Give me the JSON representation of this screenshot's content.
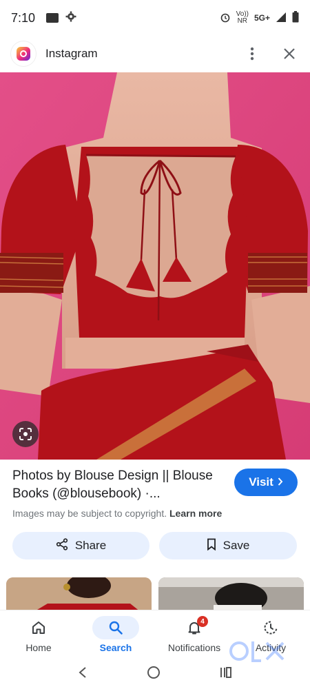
{
  "status_bar": {
    "time": "7:10",
    "network_label_top": "Vo))",
    "network_label_bottom": "NR",
    "network_type": "5G+"
  },
  "header": {
    "app_name": "Instagram",
    "logo_icon": "instagram-logo-icon",
    "more_icon": "more-vert-icon",
    "close_icon": "close-icon"
  },
  "image": {
    "lens_icon": "google-lens-icon"
  },
  "result": {
    "title": "Photos by Blouse Design || Blouse Books (@blousebook) ·...",
    "visit_label": "Visit",
    "copyright_text": "Images may be subject to copyright.",
    "learn_more": "Learn more",
    "share_label": "Share",
    "save_label": "Save"
  },
  "bottom_nav": {
    "items": [
      {
        "label": "Home",
        "icon": "home-icon"
      },
      {
        "label": "Search",
        "icon": "search-icon",
        "active": true
      },
      {
        "label": "Notifications",
        "icon": "bell-icon",
        "badge": "4"
      },
      {
        "label": "Activity",
        "icon": "activity-icon"
      }
    ]
  },
  "watermark": {
    "brand": "olx"
  },
  "colors": {
    "accent": "#1a73e8",
    "tonal_button": "#e8f0fe",
    "badge": "#d93025",
    "backdrop": "#e0447f",
    "garment": "#b3121a"
  }
}
